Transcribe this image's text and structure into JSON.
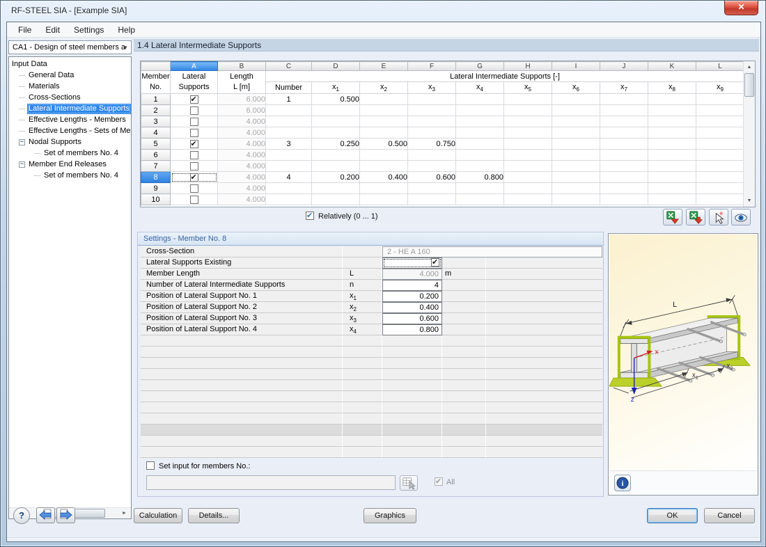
{
  "window": {
    "title": "RF-STEEL SIA - [Example SIA]"
  },
  "menu": {
    "items": [
      "File",
      "Edit",
      "Settings",
      "Help"
    ]
  },
  "navigation": {
    "case_selector": {
      "value": "CA1 - Design of steel members a"
    },
    "tree": {
      "root": "Input Data",
      "items": [
        {
          "label": "General Data",
          "level": 1
        },
        {
          "label": "Materials",
          "level": 1
        },
        {
          "label": "Cross-Sections",
          "level": 1
        },
        {
          "label": "Lateral Intermediate Supports",
          "level": 1,
          "selected": true
        },
        {
          "label": "Effective Lengths - Members",
          "level": 1
        },
        {
          "label": "Effective Lengths - Sets of Men",
          "level": 1
        },
        {
          "label": "Nodal Supports",
          "level": 1,
          "expandable": true
        },
        {
          "label": "Set of members No. 4",
          "level": 2
        },
        {
          "label": "Member End Releases",
          "level": 1,
          "expandable": true
        },
        {
          "label": "Set of members No. 4",
          "level": 2
        }
      ]
    }
  },
  "main": {
    "section_title": "1.4 Lateral Intermediate Supports",
    "table": {
      "column_letters": [
        "A",
        "B",
        "C",
        "D",
        "E",
        "F",
        "G",
        "H",
        "I",
        "J",
        "K",
        "L"
      ],
      "selected_column": "A",
      "col_member": [
        "Member",
        "No."
      ],
      "col_lateral": [
        "Lateral",
        "Supports"
      ],
      "col_length": [
        "Length",
        "L [m]"
      ],
      "group_header": "Lateral Intermediate Supports [-]",
      "col_number": "Number",
      "x_headers": [
        "x_1",
        "x_2",
        "x_3",
        "x_4",
        "x_5",
        "x_6",
        "x_7",
        "x_8",
        "x_9"
      ],
      "rows": [
        {
          "no": "1",
          "checked": true,
          "length": "6.000",
          "number": "1",
          "x": [
            "0.500"
          ]
        },
        {
          "no": "2",
          "checked": false,
          "length": "6.000",
          "number": "",
          "x": []
        },
        {
          "no": "3",
          "checked": false,
          "length": "4.000",
          "number": "",
          "x": []
        },
        {
          "no": "4",
          "checked": false,
          "length": "4.000",
          "number": "",
          "x": []
        },
        {
          "no": "5",
          "checked": true,
          "length": "4.000",
          "number": "3",
          "x": [
            "0.250",
            "0.500",
            "0.750"
          ]
        },
        {
          "no": "6",
          "checked": false,
          "length": "4.000",
          "number": "",
          "x": []
        },
        {
          "no": "7",
          "checked": false,
          "length": "4.000",
          "number": "",
          "x": []
        },
        {
          "no": "8",
          "checked": true,
          "length": "4.000",
          "number": "4",
          "x": [
            "0.200",
            "0.400",
            "0.600",
            "0.800"
          ],
          "selected": true
        },
        {
          "no": "9",
          "checked": false,
          "length": "4.000",
          "number": "",
          "x": []
        },
        {
          "no": "10",
          "checked": false,
          "length": "4.000",
          "number": "",
          "x": []
        }
      ]
    },
    "relatively": {
      "label": "Relatively (0 ... 1)",
      "checked": true
    },
    "toolbar_icons": [
      "export-excel-icon",
      "import-excel-icon",
      "pick-cell-icon",
      "view-icon"
    ]
  },
  "settings": {
    "title": "Settings - Member No. 8",
    "rows": [
      {
        "label": "Cross-Section",
        "symbol": "",
        "value": "2 - HE A 160",
        "unit": "",
        "style": "wide-disabled"
      },
      {
        "label": "Lateral Supports Existing",
        "symbol": "",
        "value": "checked",
        "unit": "",
        "style": "checkbox"
      },
      {
        "label": "Member Length",
        "symbol": "L",
        "value": "4.000",
        "unit": "m",
        "style": "disabled"
      },
      {
        "label": "Number of Lateral Intermediate Supports",
        "symbol": "n",
        "value": "4",
        "unit": "",
        "style": "edit"
      },
      {
        "label": "Position of Lateral Support No. 1",
        "symbol": "x_1",
        "value": "0.200",
        "unit": "",
        "style": "edit"
      },
      {
        "label": "Position of Lateral Support No. 2",
        "symbol": "x_2",
        "value": "0.400",
        "unit": "",
        "style": "edit"
      },
      {
        "label": "Position of Lateral Support No. 3",
        "symbol": "x_3",
        "value": "0.600",
        "unit": "",
        "style": "edit"
      },
      {
        "label": "Position of Lateral Support No. 4",
        "symbol": "x_4",
        "value": "0.800",
        "unit": "",
        "style": "edit"
      }
    ],
    "empty_rows": 11,
    "separator_row_index": 8,
    "set_input": {
      "label": "Set input for members No.:",
      "checked": false,
      "value": "",
      "all_label": "All",
      "all_checked": true,
      "all_disabled": true
    }
  },
  "graphic": {
    "labels": {
      "length": "L",
      "axis_x": "x",
      "axis_z": "z",
      "pos1": "x_1",
      "pos2": "x_2"
    }
  },
  "footer": {
    "calculation": "Calculation",
    "details": "Details...",
    "graphics": "Graphics",
    "ok": "OK",
    "cancel": "Cancel"
  },
  "colors": {
    "accent_blue": "#2f86e8",
    "header_bar": "#c6d5e4",
    "settings_title": "#3a62a0",
    "support_green": "#bcd02a",
    "axis_red": "#cf1f1f",
    "axis_blue": "#1822c8",
    "disabled_text": "#a0a0a0",
    "diagram_bg": "#fbf1cf",
    "close_red": "#c0382a"
  },
  "icons": {
    "close": "✕",
    "dropdown": "▼",
    "scroll_up": "▲",
    "scroll_down": "▼",
    "scroll_left": "◄",
    "scroll_right": "►",
    "check": "✔",
    "help": "?",
    "info": "i",
    "collapse": "−"
  }
}
